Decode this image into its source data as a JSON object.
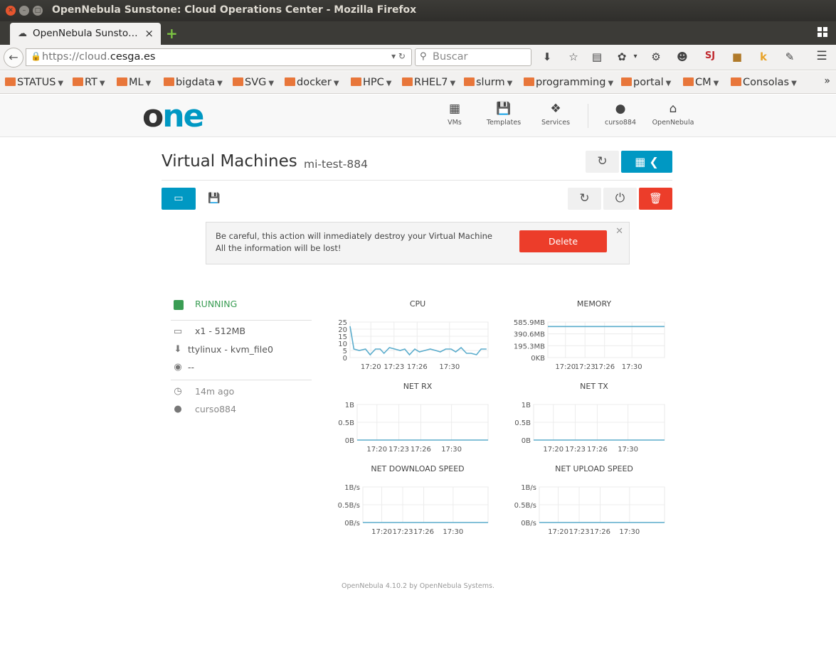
{
  "window": {
    "title": "OpenNebula Sunstone: Cloud Operations Center - Mozilla Firefox"
  },
  "browser": {
    "tab_title": "OpenNebula Sunsto…",
    "url_prefix": "https://cloud.",
    "url_domain": "cesga.es",
    "search_placeholder": "Buscar",
    "bookmarks": [
      "STATUS",
      "RT",
      "ML",
      "bigdata",
      "SVG",
      "docker",
      "HPC",
      "RHEL7",
      "slurm",
      "programming",
      "portal",
      "CM",
      "Consolas"
    ]
  },
  "header": {
    "logo_o": "o",
    "logo_ne": "ne",
    "nav": [
      {
        "label": "VMs",
        "icon": "grid-icon"
      },
      {
        "label": "Templates",
        "icon": "floppy-icon"
      },
      {
        "label": "Services",
        "icon": "cubes-icon"
      },
      {
        "label": "curso884",
        "icon": "user-icon"
      },
      {
        "label": "OpenNebula",
        "icon": "home-icon"
      }
    ]
  },
  "page": {
    "title": "Virtual Machines",
    "subtitle": "mi-test-884"
  },
  "confirm": {
    "line1": "Be careful, this action will inmediately destroy your Virtual Machine",
    "line2": "All the information will be lost!",
    "delete_label": "Delete"
  },
  "vm": {
    "state": "RUNNING",
    "state_color": "#3a9d54",
    "capacity": "x1 - 512MB",
    "image": "ttylinux - kvm_file0",
    "ip": "--",
    "age": "14m ago",
    "owner": "curso884"
  },
  "accent_color": "#0098c3",
  "danger_color": "#ec3d2a",
  "chart_data": [
    {
      "type": "line",
      "title": "CPU",
      "x_ticks": [
        "17:20",
        "17:23",
        "17:26",
        "17:30"
      ],
      "y_ticks": [
        "25",
        "20",
        "15",
        "10",
        "5",
        "0"
      ],
      "ylim": [
        0,
        25
      ],
      "x_domain_minutes": [
        17.3,
        35.2
      ],
      "series": [
        {
          "values": [
            [
              17.3,
              22
            ],
            [
              17.8,
              6
            ],
            [
              18.5,
              5
            ],
            [
              19.3,
              6
            ],
            [
              19.9,
              2
            ],
            [
              20.6,
              6
            ],
            [
              21.2,
              6
            ],
            [
              21.7,
              3
            ],
            [
              22.4,
              7
            ],
            [
              23.1,
              6
            ],
            [
              23.8,
              5
            ],
            [
              24.4,
              6
            ],
            [
              25.0,
              2
            ],
            [
              25.7,
              6
            ],
            [
              26.3,
              4
            ],
            [
              27.0,
              5
            ],
            [
              27.7,
              6
            ],
            [
              28.4,
              5
            ],
            [
              29.0,
              4
            ],
            [
              29.7,
              6
            ],
            [
              30.4,
              6
            ],
            [
              31.0,
              4
            ],
            [
              31.7,
              7
            ],
            [
              32.4,
              3
            ],
            [
              33.0,
              3
            ],
            [
              33.7,
              2
            ],
            [
              34.3,
              6
            ],
            [
              35.0,
              6
            ]
          ]
        }
      ]
    },
    {
      "type": "line",
      "title": "MEMORY",
      "x_ticks": [
        "17:20",
        "17:23",
        "17:26",
        "17:30"
      ],
      "y_ticks": [
        "585.9MB",
        "390.6MB",
        "195.3MB",
        "0KB"
      ],
      "ylim": [
        0,
        585.9
      ],
      "x_domain_minutes": [
        17.3,
        35.2
      ],
      "series": [
        {
          "values": [
            [
              17.3,
              512
            ],
            [
              35.2,
              512
            ]
          ]
        }
      ]
    },
    {
      "type": "line",
      "title": "NET RX",
      "x_ticks": [
        "17:20",
        "17:23",
        "17:26",
        "17:30"
      ],
      "y_ticks": [
        "1B",
        "0.5B",
        "0B"
      ],
      "ylim": [
        0,
        1
      ],
      "x_domain_minutes": [
        17.3,
        35.2
      ],
      "series": [
        {
          "values": [
            [
              17.3,
              0
            ],
            [
              35.2,
              0
            ]
          ]
        }
      ]
    },
    {
      "type": "line",
      "title": "NET TX",
      "x_ticks": [
        "17:20",
        "17:23",
        "17:26",
        "17:30"
      ],
      "y_ticks": [
        "1B",
        "0.5B",
        "0B"
      ],
      "ylim": [
        0,
        1
      ],
      "x_domain_minutes": [
        17.3,
        35.2
      ],
      "series": [
        {
          "values": [
            [
              17.3,
              0
            ],
            [
              35.2,
              0
            ]
          ]
        }
      ]
    },
    {
      "type": "line",
      "title": "NET DOWNLOAD SPEED",
      "x_ticks": [
        "17:20",
        "17:23",
        "17:26",
        "17:30"
      ],
      "y_ticks": [
        "1B/s",
        "0.5B/s",
        "0B/s"
      ],
      "ylim": [
        0,
        1
      ],
      "x_domain_minutes": [
        17.3,
        35.2
      ],
      "series": [
        {
          "values": [
            [
              17.3,
              0
            ],
            [
              35.2,
              0
            ]
          ]
        }
      ]
    },
    {
      "type": "line",
      "title": "NET UPLOAD SPEED",
      "x_ticks": [
        "17:20",
        "17:23",
        "17:26",
        "17:30"
      ],
      "y_ticks": [
        "1B/s",
        "0.5B/s",
        "0B/s"
      ],
      "ylim": [
        0,
        1
      ],
      "x_domain_minutes": [
        17.3,
        35.2
      ],
      "series": [
        {
          "values": [
            [
              17.3,
              0
            ],
            [
              35.2,
              0
            ]
          ]
        }
      ]
    }
  ],
  "footer": "OpenNebula 4.10.2 by OpenNebula Systems."
}
